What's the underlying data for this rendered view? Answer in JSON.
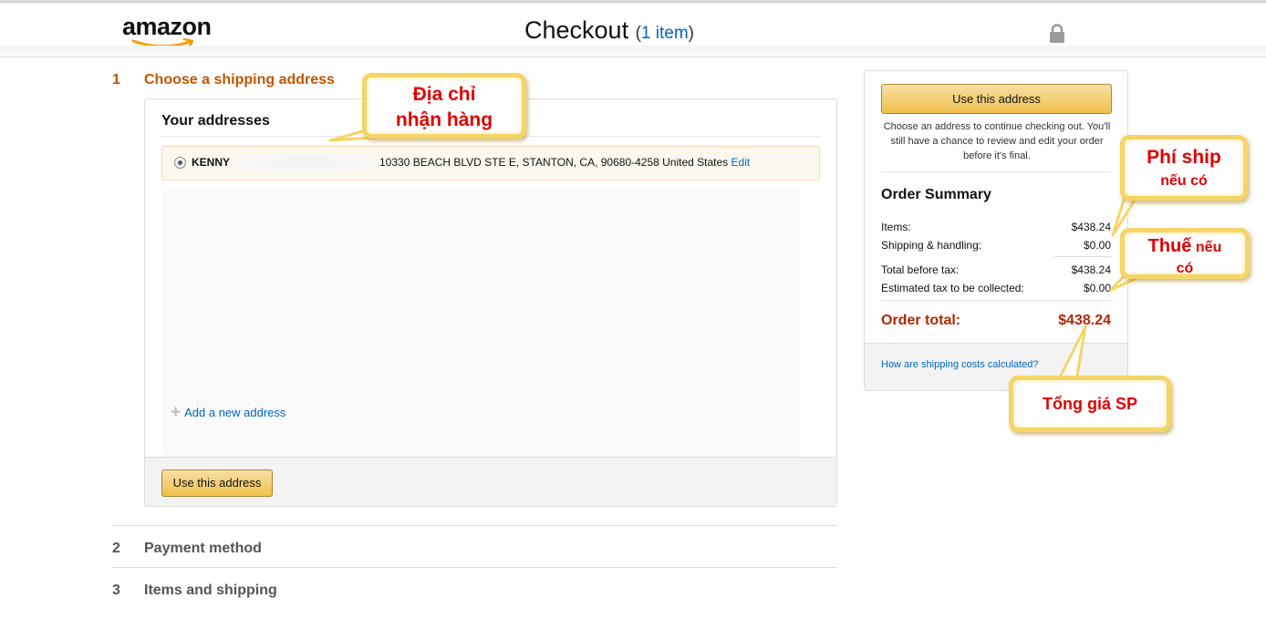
{
  "header": {
    "logo_text": "amazon",
    "title": "Checkout",
    "item_count_prefix": "(",
    "item_count": "1 item",
    "item_count_suffix": ")"
  },
  "steps": [
    {
      "number": "1",
      "title": "Choose a shipping address"
    },
    {
      "number": "2",
      "title": "Payment method"
    },
    {
      "number": "3",
      "title": "Items and shipping"
    }
  ],
  "addresses": {
    "heading": "Your addresses",
    "selected": {
      "name": "KENNY",
      "address": "10330 BEACH BLVD STE E, STANTON, CA, 90680-4258 United States",
      "edit_label": "Edit"
    },
    "add_new_label": "Add a new address",
    "use_button_label": "Use this address"
  },
  "summary": {
    "use_button_label": "Use this address",
    "note": "Choose an address to continue checking out. You'll still have a chance to review and edit your order before it's final.",
    "title": "Order Summary",
    "rows": [
      {
        "label": "Items:",
        "value": "$438.24"
      },
      {
        "label": "Shipping & handling:",
        "value": "$0.00"
      },
      {
        "label": "Total before tax:",
        "value": "$438.24"
      },
      {
        "label": "Estimated tax to be collected:",
        "value": "$0.00"
      }
    ],
    "total_label": "Order total:",
    "total_value": "$438.24",
    "shipping_costs_link": "How are shipping costs calculated?"
  },
  "annotations": {
    "address": {
      "line1": "Địa chỉ",
      "line2": "nhận hàng"
    },
    "shipping_fee": {
      "line1": "Phí ship",
      "line2": "nếu có"
    },
    "tax": {
      "line1": "Thuế",
      "line1b": "nếu",
      "line2": "có"
    },
    "total": {
      "text": "Tổng giá SP"
    }
  },
  "colors": {
    "accent_orange": "#c45500",
    "link_blue": "#0066c0",
    "price_red": "#b12704",
    "button_yellow": "#f0c14b",
    "callout_border": "#f5d565",
    "callout_text": "#e00000"
  }
}
